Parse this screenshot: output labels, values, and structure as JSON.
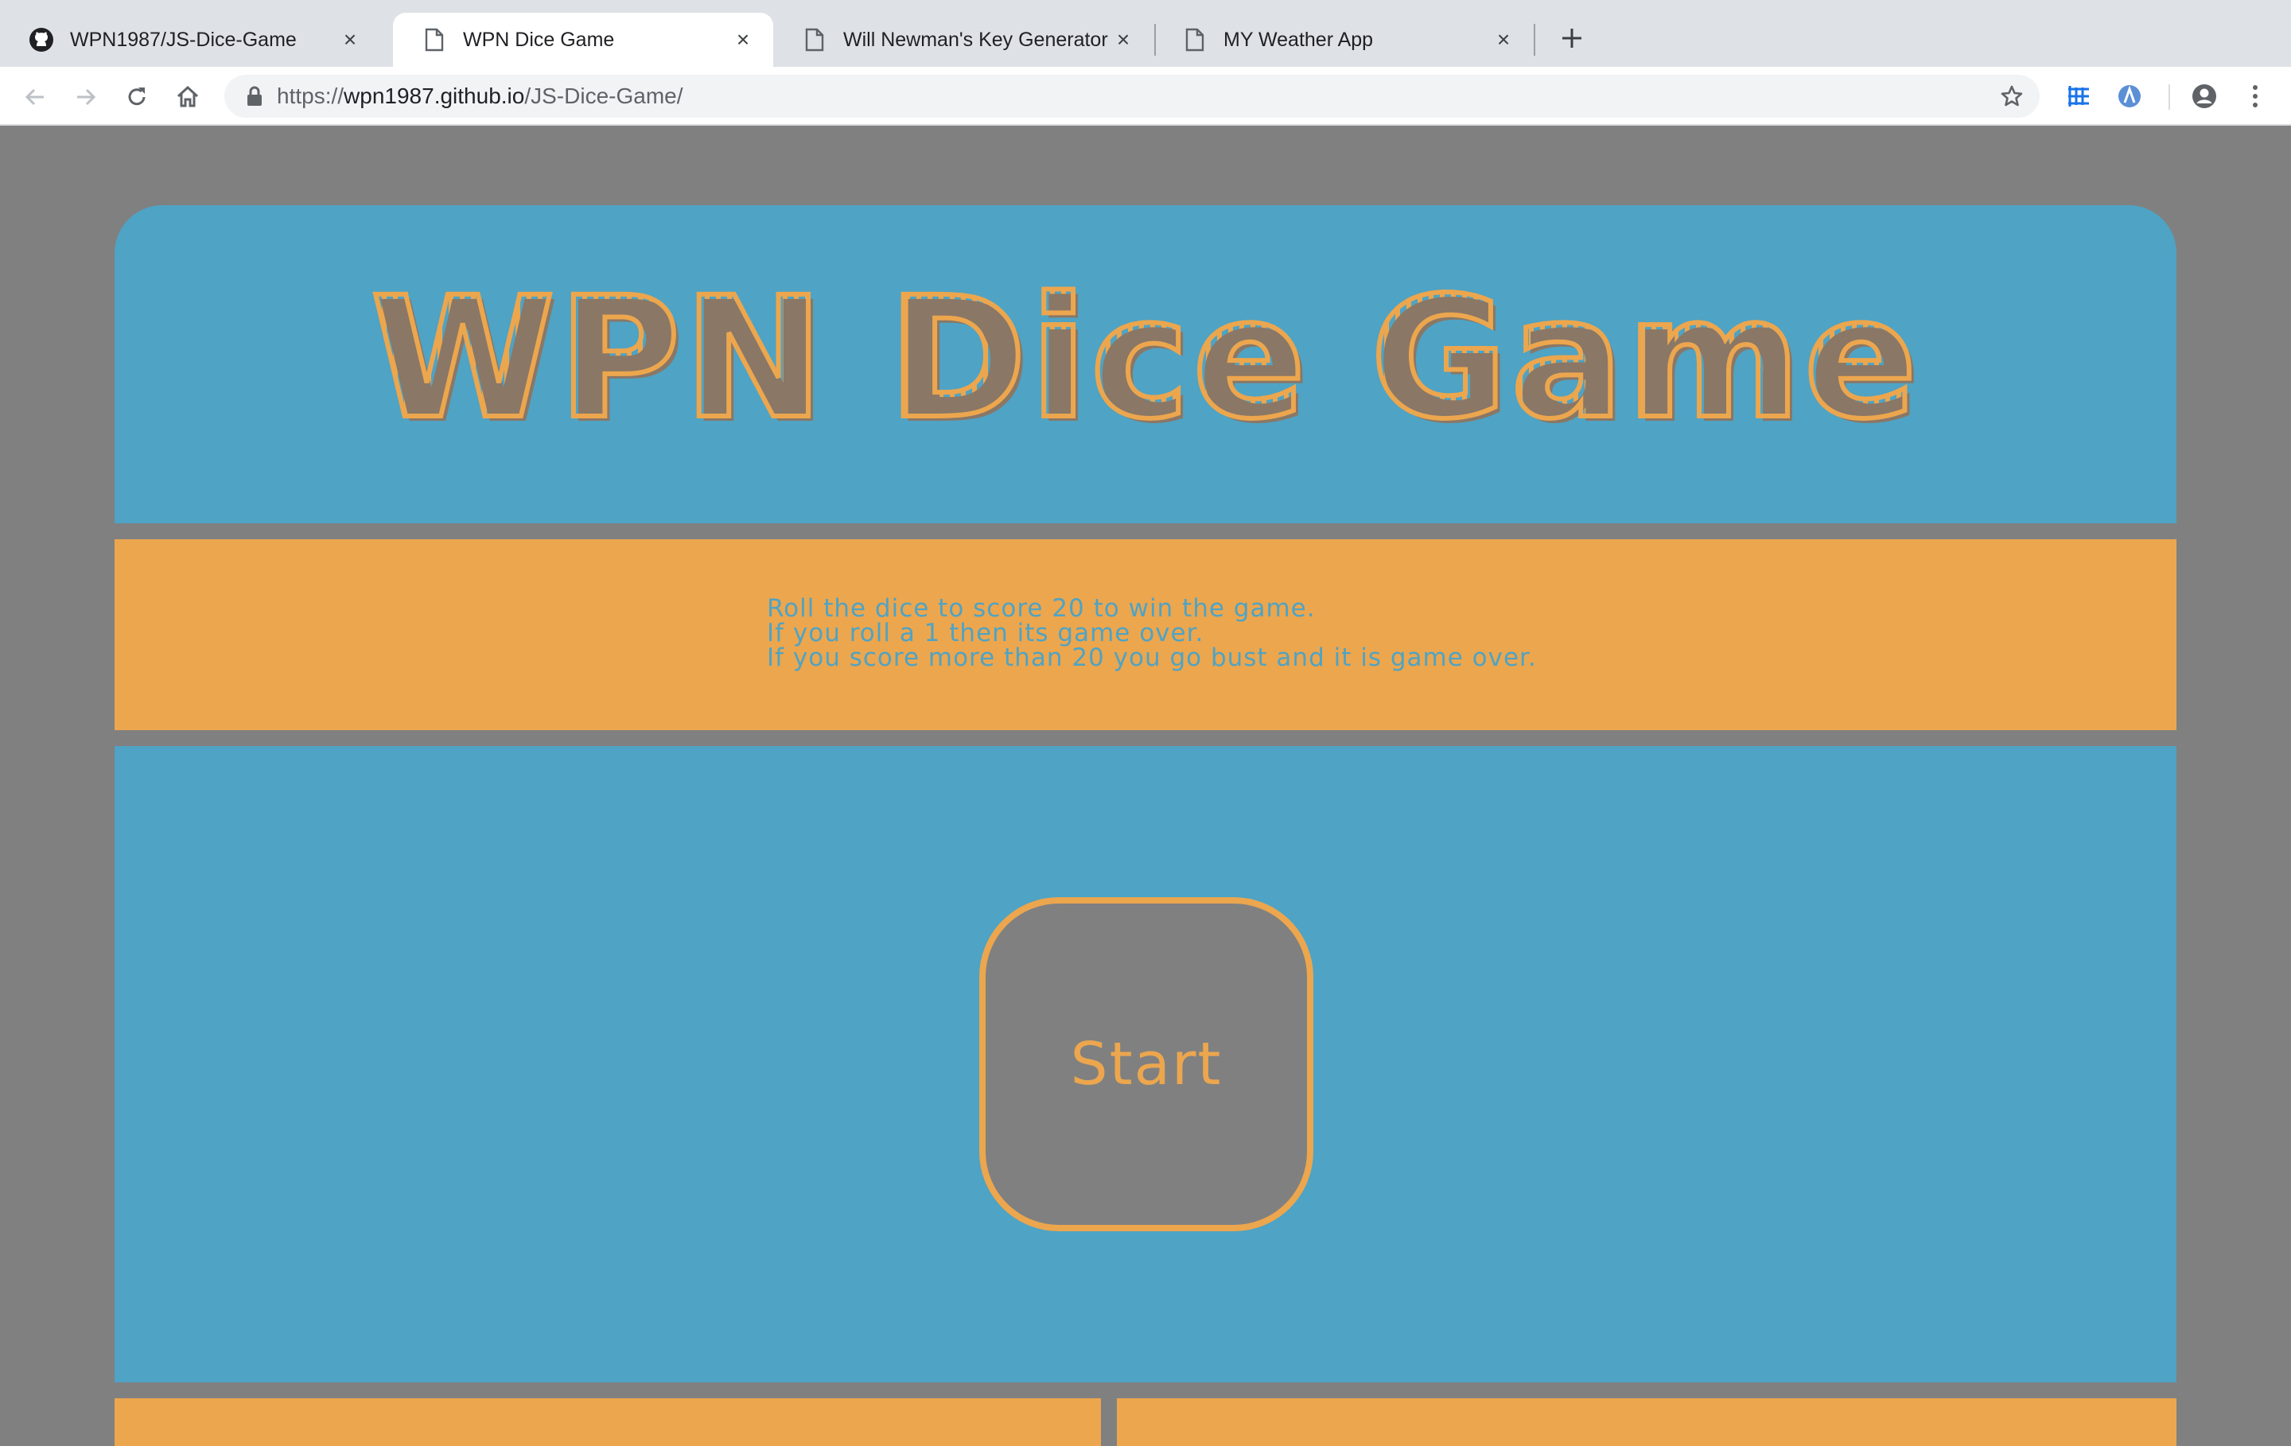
{
  "browser": {
    "tabs": [
      {
        "title": "WPN1987/JS-Dice-Game",
        "icon": "github-icon",
        "active": false
      },
      {
        "title": "WPN Dice Game",
        "icon": "page-icon",
        "active": true
      },
      {
        "title": "Will Newman's Key Generator",
        "icon": "page-icon",
        "active": false
      },
      {
        "title": "MY Weather App",
        "icon": "page-icon",
        "active": false
      }
    ],
    "url": {
      "scheme": "https://",
      "host": "wpn1987.github.io",
      "path": "/JS-Dice-Game/"
    }
  },
  "page": {
    "title": "WPN Dice Game",
    "rules": [
      "Roll the dice to score 20 to win the game.",
      "If you roll a 1 then its game over.",
      "If you score more than 20 you go bust and it is game over."
    ],
    "start_label": "Start"
  },
  "colors": {
    "blue": "#4fa3c4",
    "orange": "#eca64e",
    "gray": "#808080"
  }
}
